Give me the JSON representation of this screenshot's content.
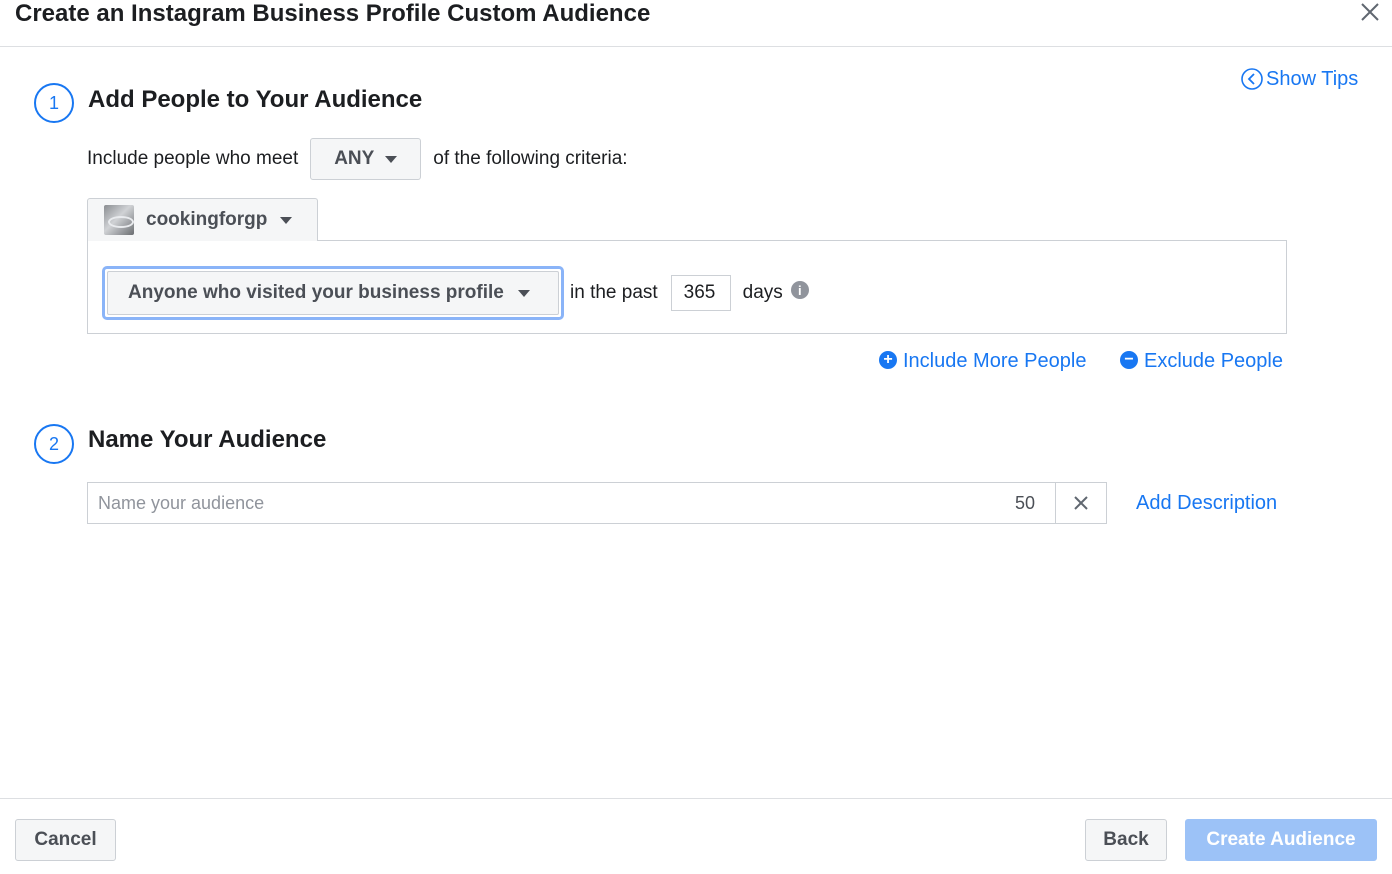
{
  "dialog": {
    "title": "Create an Instagram Business Profile Custom Audience",
    "show_tips": "Show Tips"
  },
  "step1": {
    "number": "1",
    "title": "Add People to Your Audience",
    "include_prefix": "Include people who meet",
    "match_mode": "ANY",
    "include_suffix": "of the following criteria:",
    "account_name": "cookingforgp",
    "rule_option": "Anyone who visited your business profile",
    "in_the_past": "in the past",
    "days_value": "365",
    "days_label": "days",
    "include_more": "Include More People",
    "exclude": "Exclude People"
  },
  "step2": {
    "number": "2",
    "title": "Name Your Audience",
    "name_placeholder": "Name your audience",
    "name_value": "",
    "char_limit": "50",
    "add_description": "Add Description"
  },
  "footer": {
    "cancel": "Cancel",
    "back": "Back",
    "create": "Create Audience"
  },
  "colors": {
    "accent": "#1877f2",
    "focus_ring": "#8ab4f8",
    "disabled_primary": "#9cc2f7"
  },
  "icons": {
    "close": "close-icon",
    "tips": "chevron-left-circle-icon",
    "info": "info-icon",
    "plus": "plus-circle-icon",
    "minus": "minus-circle-icon",
    "clear": "clear-x-icon"
  }
}
